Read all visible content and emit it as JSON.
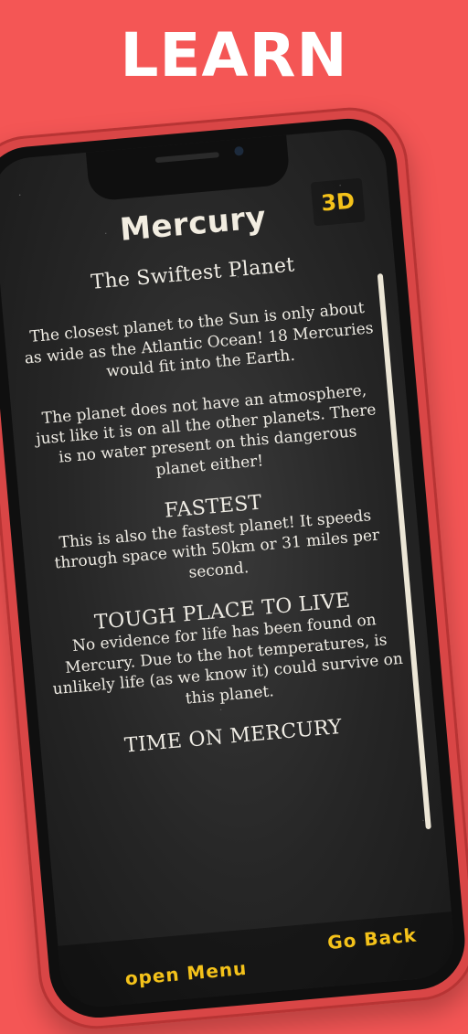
{
  "banner": {
    "title": "LEARN"
  },
  "screen": {
    "planet_title": "Mercury",
    "view_3d_label": "3D"
  },
  "content": {
    "sections": [
      {
        "heading": "The Swiftest Planet",
        "paragraphs": [
          "The closest planet to the Sun is only about as wide as the Atlantic Ocean! 18 Mercuries would fit into the Earth.",
          "The planet does not have an atmosphere, just like it is on all the other planets. There is no water present on this dangerous planet either!"
        ]
      },
      {
        "heading": "FASTEST",
        "paragraphs": [
          "This is also the fastest planet! It speeds through space with 50km or 31 miles per second."
        ]
      },
      {
        "heading": "TOUGH PLACE TO LIVE",
        "paragraphs": [
          "No evidence for life has been found on Mercury. Due to the hot temperatures, is unlikely life (as we know it) could survive on this planet."
        ]
      },
      {
        "heading": "TIME ON MERCURY",
        "paragraphs": []
      }
    ]
  },
  "footer": {
    "open_menu_label": "open Menu",
    "go_back_label": "Go Back"
  },
  "colors": {
    "background": "#f45655",
    "accent": "#f4c21a",
    "text": "#efece4"
  }
}
